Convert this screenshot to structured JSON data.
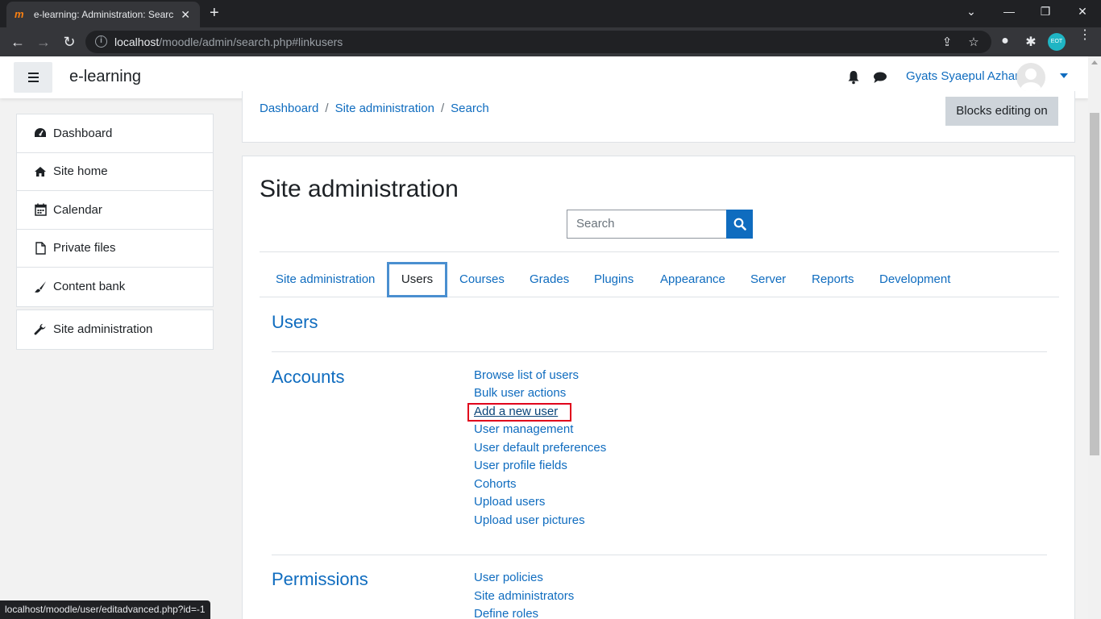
{
  "browser": {
    "tab_title": "e-learning: Administration: Search",
    "favicon": "m",
    "url_host": "localhost",
    "url_path": "/moodle/admin/search.php#linkusers",
    "profile_initials": "EOT",
    "status_url": "localhost/moodle/user/editadvanced.php?id=-1"
  },
  "navbar": {
    "brand": "e-learning",
    "user_name": "Gyats Syaepul Azhar"
  },
  "drawer": {
    "items": [
      {
        "label": "Dashboard",
        "icon": "dashboard-icon"
      },
      {
        "label": "Site home",
        "icon": "home-icon"
      },
      {
        "label": "Calendar",
        "icon": "calendar-icon"
      },
      {
        "label": "Private files",
        "icon": "file-icon"
      },
      {
        "label": "Content bank",
        "icon": "brush-icon"
      }
    ],
    "admin_item": {
      "label": "Site administration",
      "icon": "wrench-icon"
    }
  },
  "breadcrumb": [
    "Dashboard",
    "Site administration",
    "Search"
  ],
  "blocks_button": "Blocks editing on",
  "page_title": "Site administration",
  "search": {
    "placeholder": "Search"
  },
  "tabs": [
    {
      "label": "Site administration",
      "active": false
    },
    {
      "label": "Users",
      "active": true
    },
    {
      "label": "Courses",
      "active": false
    },
    {
      "label": "Grades",
      "active": false
    },
    {
      "label": "Plugins",
      "active": false
    },
    {
      "label": "Appearance",
      "active": false
    },
    {
      "label": "Server",
      "active": false
    },
    {
      "label": "Reports",
      "active": false
    },
    {
      "label": "Development",
      "active": false
    }
  ],
  "users_heading": "Users",
  "accounts": {
    "title": "Accounts",
    "links": [
      "Browse list of users",
      "Bulk user actions",
      "Add a new user",
      "User management",
      "User default preferences",
      "User profile fields",
      "Cohorts",
      "Upload users",
      "Upload user pictures"
    ]
  },
  "permissions": {
    "title": "Permissions",
    "links": [
      "User policies",
      "Site administrators",
      "Define roles"
    ]
  },
  "colors": {
    "link": "#0f6cbf",
    "highlight_box": "#e0001b",
    "active_tab_border": "#4a8fd0"
  }
}
